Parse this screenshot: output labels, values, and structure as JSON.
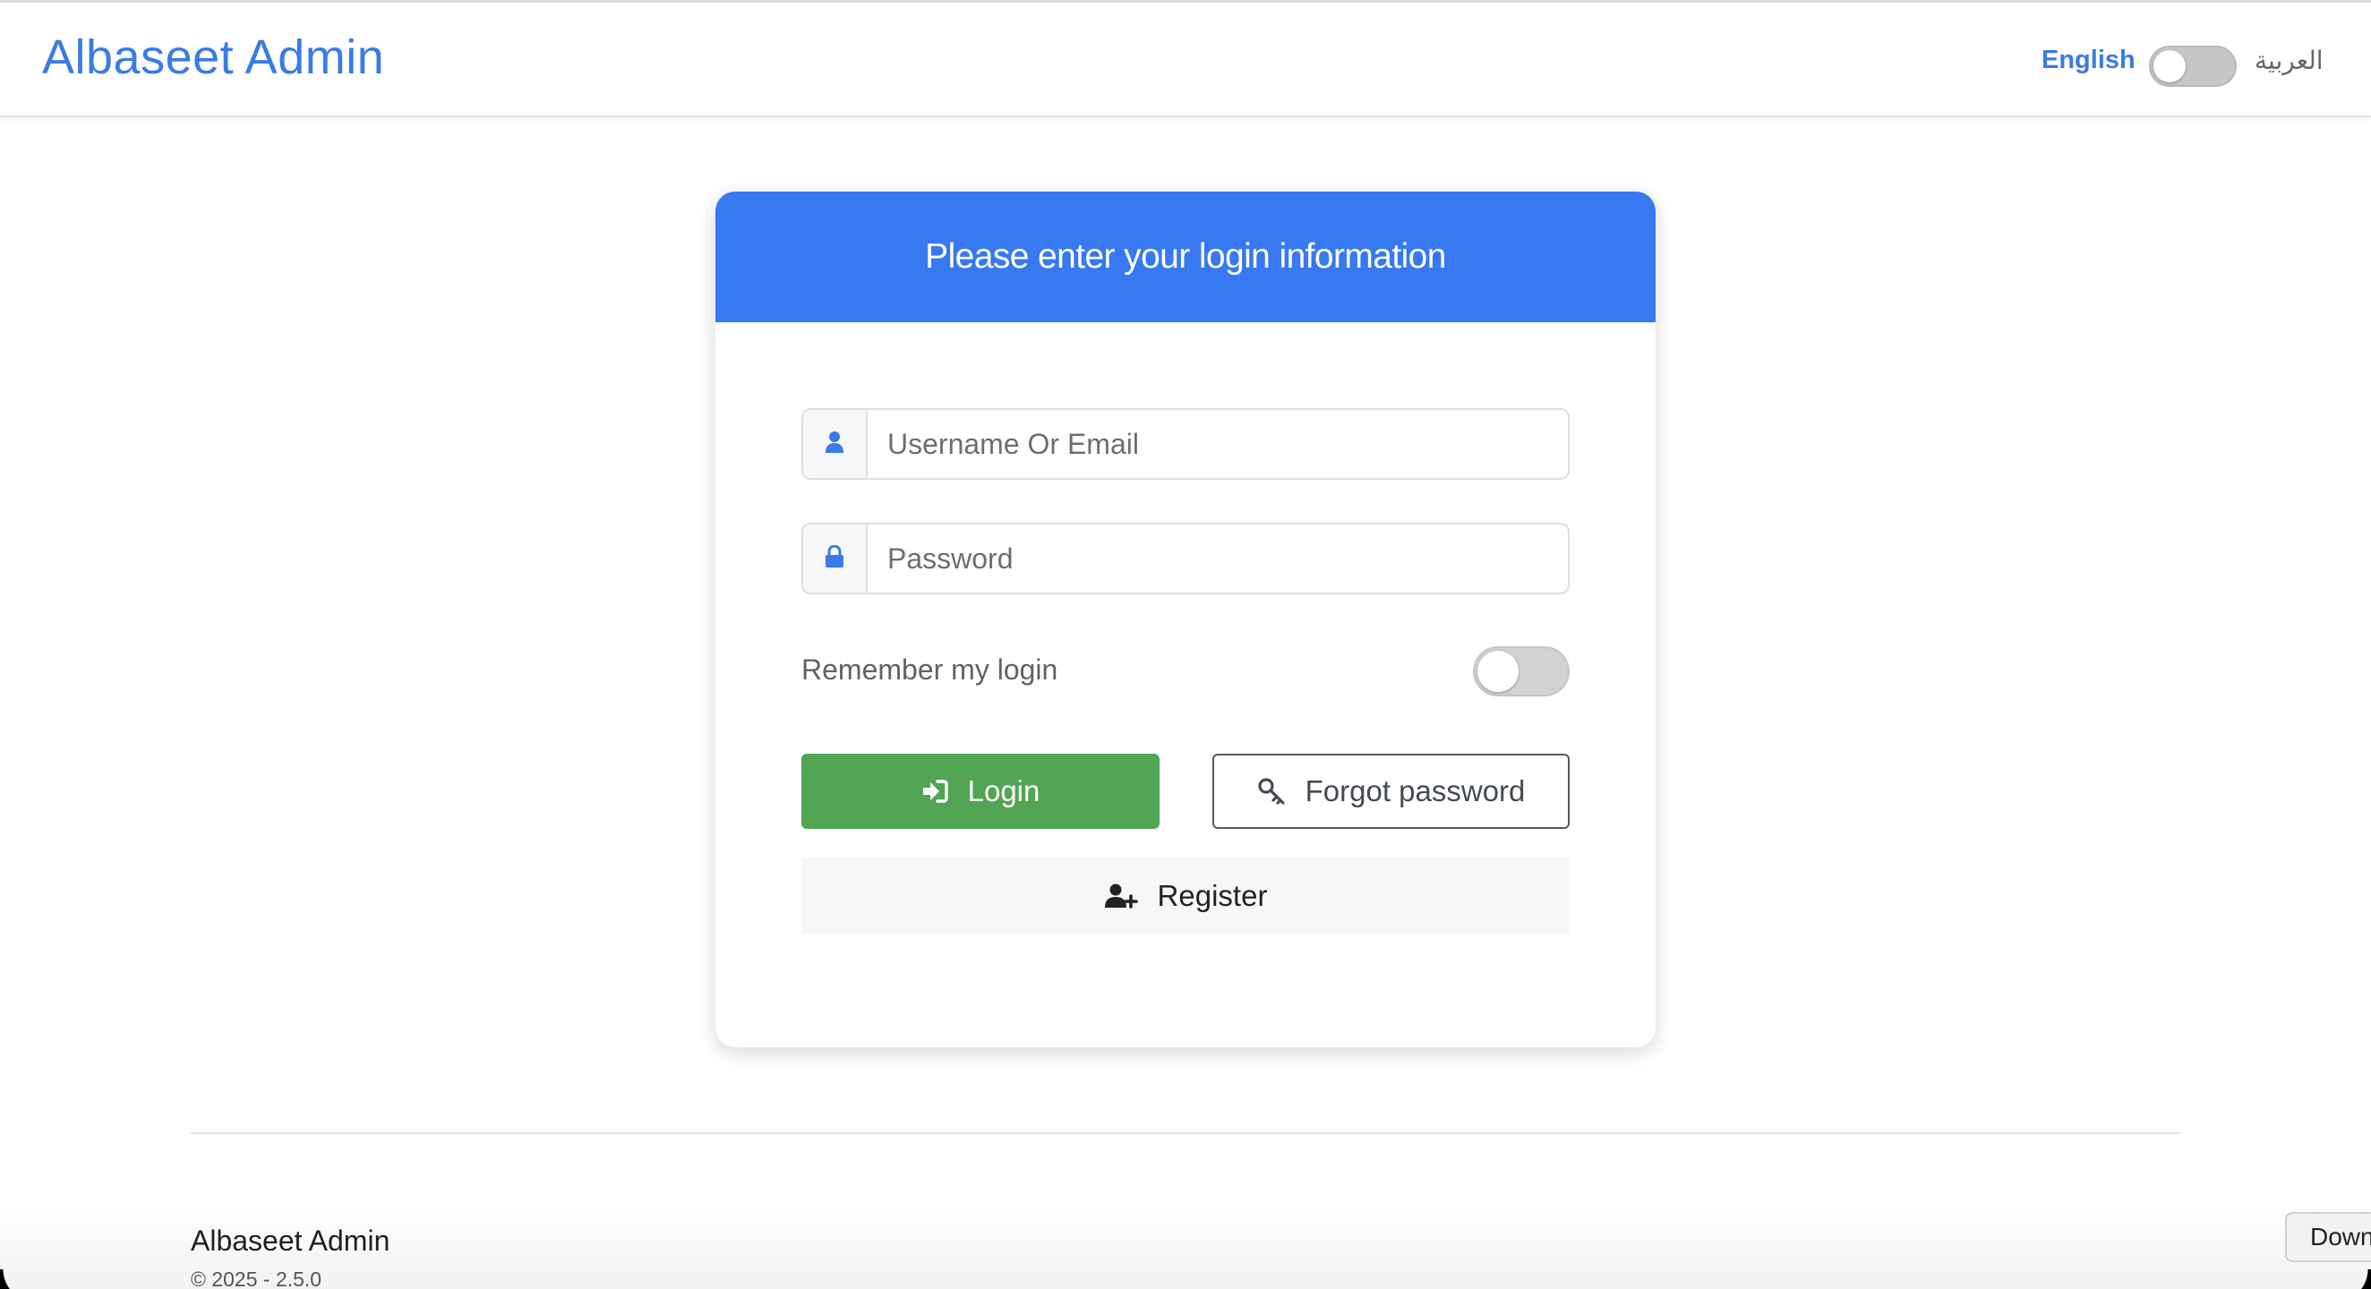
{
  "navbar": {
    "brand": "Albaseet Admin",
    "lang_english": "English",
    "lang_arabic": "العربية",
    "lang_toggle_on": false
  },
  "login_card": {
    "title": "Please enter your login information",
    "username_placeholder": "Username Or Email",
    "password_placeholder": "Password",
    "remember_label": "Remember my login",
    "remember_on": false,
    "login_label": "Login",
    "forgot_label": "Forgot password",
    "register_label": "Register"
  },
  "footer": {
    "brand": "Albaseet Admin",
    "version": "© 2025 - 2.5.0"
  },
  "overlay": {
    "down_label": "Down"
  },
  "icons": {
    "user": "user-icon",
    "lock": "lock-icon",
    "sign_in": "sign-in-icon",
    "key": "key-icon",
    "user_plus": "user-plus-icon"
  },
  "colors": {
    "brand": "#3a7be6",
    "header": "#3779f0",
    "login_button": "#52a552"
  }
}
